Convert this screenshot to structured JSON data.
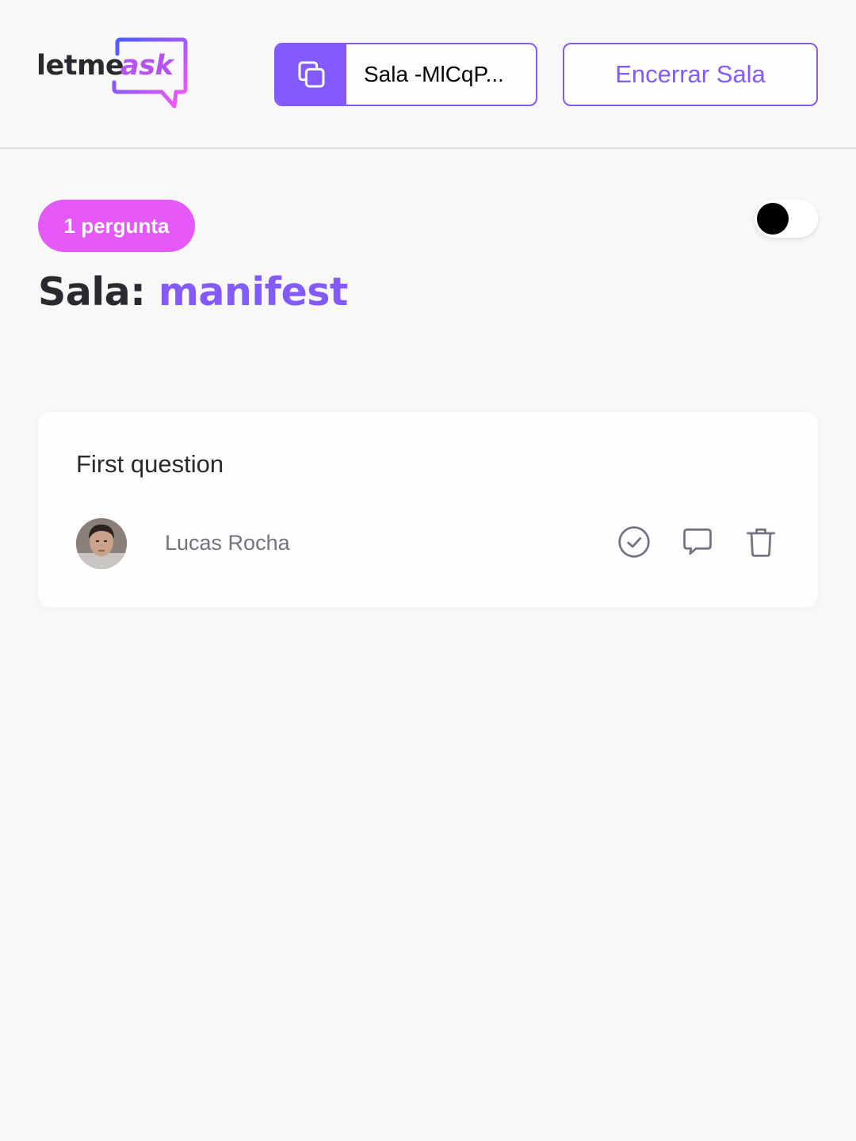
{
  "header": {
    "logo": {
      "word_letme": "letme",
      "word_ask": "ask"
    },
    "room_code": {
      "label": "Sala -MlCqP...",
      "icon": "copy-icon"
    },
    "close_room_label": "Encerrar Sala"
  },
  "main": {
    "question_count_badge": "1 pergunta",
    "theme_toggle": {
      "state": "off"
    },
    "title_prefix": "Sala: ",
    "room_name": "manifest",
    "questions": [
      {
        "text": "First question",
        "author": "Lucas Rocha",
        "actions": [
          "check-circle-icon",
          "message-icon",
          "trash-icon"
        ]
      }
    ]
  },
  "colors": {
    "accent": "#835afd",
    "badge": "#e559f9",
    "background": "#f8f8f8",
    "text_dark": "#29292e",
    "text_muted": "#737380"
  }
}
